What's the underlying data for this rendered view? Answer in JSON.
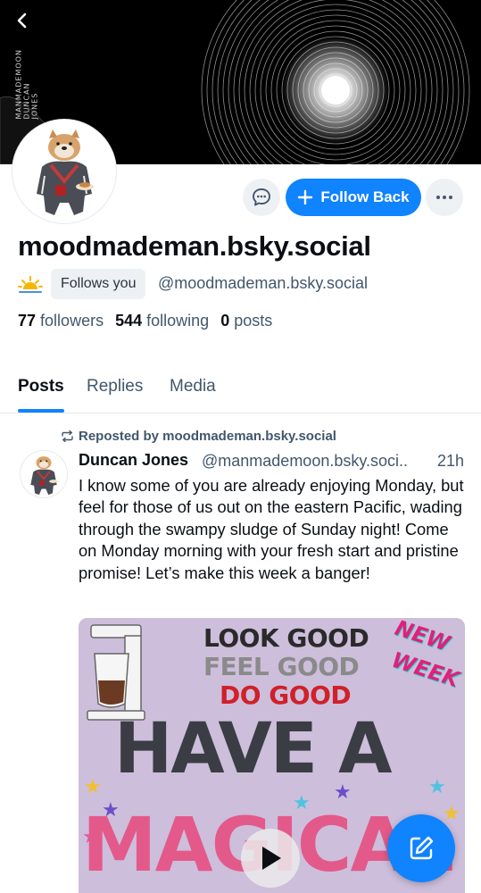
{
  "banner": {
    "vertical_text_lines": [
      "MANMADEMOON",
      "DUNCAN",
      "JONES"
    ]
  },
  "header": {
    "back_icon": "chevron-left-icon"
  },
  "profile": {
    "display_name": "moodmademan.bsky.social",
    "follows_you_label": "Follows you",
    "handle": "@moodmademan.bsky.social",
    "status_icon": "sun-icon",
    "avatar_icon": "dog-in-tracksuit-avatar"
  },
  "actions": {
    "message_icon": "chat-bubble-icon",
    "follow_back_label": "Follow Back",
    "more_icon": "ellipsis-icon"
  },
  "stats": {
    "followers_count": "77",
    "followers_label": "followers",
    "following_count": "544",
    "following_label": "following",
    "posts_count": "0",
    "posts_label": "posts"
  },
  "tabs": [
    {
      "label": "Posts",
      "active": true
    },
    {
      "label": "Replies",
      "active": false
    },
    {
      "label": "Media",
      "active": false
    }
  ],
  "post": {
    "repost_label": "Reposted by moodmademan.bsky.social",
    "author": "Duncan Jones",
    "handle": "@manmademoon.bsky.soci..",
    "time": "21h",
    "text": "I know some of you are already enjoying Monday, but feel for those of us out on the eastern Pacific, wading through the swampy sludge of Sunday night!  Come on Monday morning with your fresh start and pristine promise!  Let’s make this week a banger!",
    "image": {
      "line1": "LOOK GOOD",
      "line2": "FEEL GOOD",
      "line3": "DO GOOD",
      "badge1": "NEW",
      "badge2": "WEEK",
      "big1": "HAVE A",
      "big2": "MAGICAL"
    }
  },
  "colors": {
    "accent": "#1083fe",
    "text_primary": "#0b0f14",
    "text_secondary": "#42576c",
    "chip_bg": "#eef1f4"
  }
}
